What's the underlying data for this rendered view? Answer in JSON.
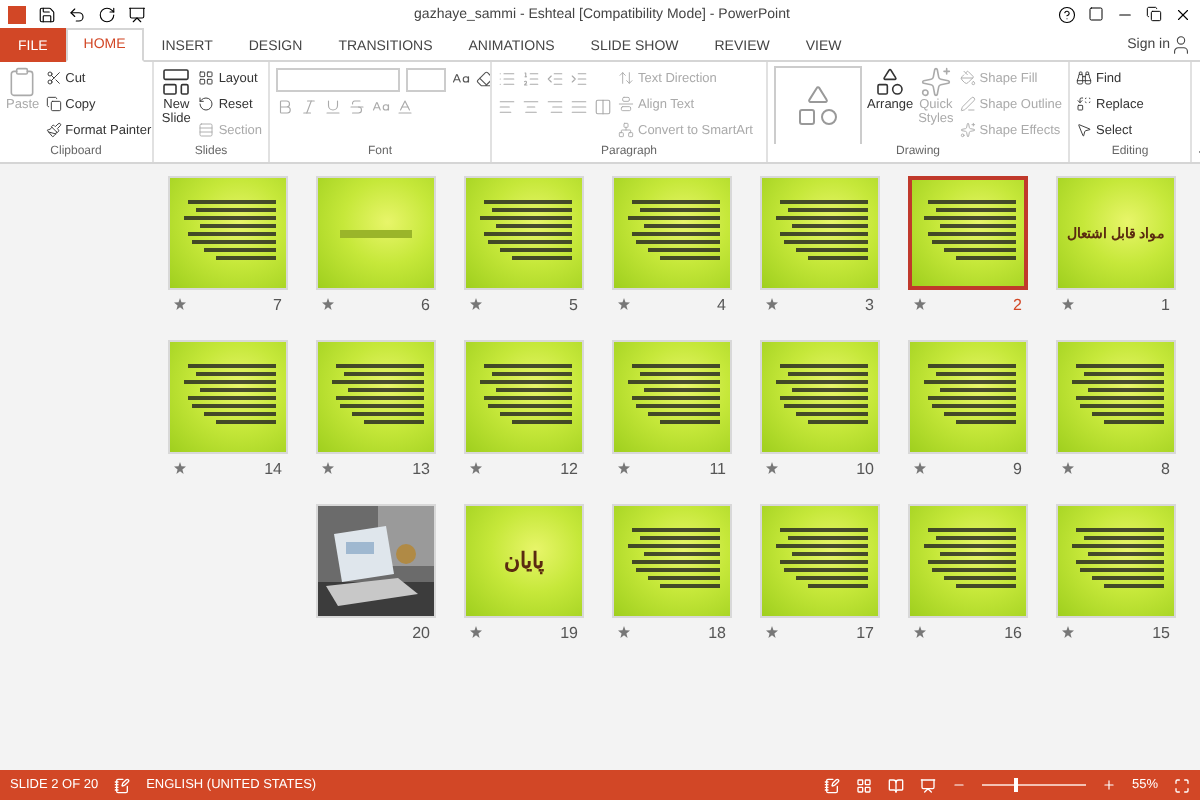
{
  "window": {
    "title": "gazhaye_sammi - Eshteal [Compatibility Mode] - PowerPoint"
  },
  "tabs": [
    {
      "label": "FILE",
      "kind": "file",
      "selected": false
    },
    {
      "label": "HOME",
      "kind": "tab",
      "selected": true
    },
    {
      "label": "INSERT",
      "kind": "tab",
      "selected": false
    },
    {
      "label": "DESIGN",
      "kind": "tab",
      "selected": false
    },
    {
      "label": "TRANSITIONS",
      "kind": "tab",
      "selected": false
    },
    {
      "label": "ANIMATIONS",
      "kind": "tab",
      "selected": false
    },
    {
      "label": "SLIDE SHOW",
      "kind": "tab",
      "selected": false
    },
    {
      "label": "REVIEW",
      "kind": "tab",
      "selected": false
    },
    {
      "label": "VIEW",
      "kind": "tab",
      "selected": false
    }
  ],
  "account": {
    "label": "Sign in"
  },
  "ribbon": {
    "groups": [
      {
        "label": "Clipboard",
        "commands": [
          {
            "label": "Paste",
            "kind": "large",
            "disabled": true
          },
          {
            "label": "Cut",
            "kind": "small",
            "disabled": false
          },
          {
            "label": "Copy",
            "kind": "small",
            "disabled": false
          },
          {
            "label": "Format Painter",
            "kind": "small",
            "disabled": false
          }
        ]
      },
      {
        "label": "Slides",
        "commands": [
          {
            "label": "New Slide",
            "kind": "large",
            "disabled": false
          },
          {
            "label": "Layout",
            "kind": "small",
            "disabled": false
          },
          {
            "label": "Reset",
            "kind": "small",
            "disabled": false
          },
          {
            "label": "Section",
            "kind": "small",
            "disabled": true
          }
        ]
      },
      {
        "label": "Font"
      },
      {
        "label": "Paragraph",
        "commands": [
          {
            "label": "Text Direction",
            "kind": "small",
            "disabled": true
          },
          {
            "label": "Align Text",
            "kind": "small",
            "disabled": true
          },
          {
            "label": "Convert to SmartArt",
            "kind": "small",
            "disabled": true
          }
        ]
      },
      {
        "label": "Drawing",
        "commands": [
          {
            "label": "Arrange",
            "kind": "large",
            "disabled": false
          },
          {
            "label": "Quick Styles",
            "kind": "large",
            "disabled": true
          },
          {
            "label": "Shape Fill",
            "kind": "small",
            "disabled": true
          },
          {
            "label": "Shape Outline",
            "kind": "small",
            "disabled": true
          },
          {
            "label": "Shape Effects",
            "kind": "small",
            "disabled": true
          }
        ]
      },
      {
        "label": "Editing",
        "commands": [
          {
            "label": "Find",
            "kind": "small",
            "disabled": false
          },
          {
            "label": "Replace",
            "kind": "small",
            "disabled": false
          },
          {
            "label": "Select",
            "kind": "small",
            "disabled": false
          }
        ]
      }
    ]
  },
  "slide_rows": [
    [
      {
        "number": "7",
        "kind": "text",
        "selected": false,
        "transition": true
      },
      {
        "number": "6",
        "kind": "faint",
        "selected": false,
        "transition": true
      },
      {
        "number": "5",
        "kind": "text",
        "selected": false,
        "transition": true
      },
      {
        "number": "4",
        "kind": "text",
        "selected": false,
        "transition": true
      },
      {
        "number": "3",
        "kind": "text",
        "selected": false,
        "transition": true
      },
      {
        "number": "2",
        "kind": "text",
        "selected": true,
        "transition": true
      },
      {
        "number": "1",
        "kind": "title",
        "title": "مواد قابل اشتعال",
        "selected": false,
        "transition": true
      }
    ],
    [
      {
        "number": "14",
        "kind": "text",
        "selected": false,
        "transition": true
      },
      {
        "number": "13",
        "kind": "text",
        "selected": false,
        "transition": true
      },
      {
        "number": "12",
        "kind": "text",
        "selected": false,
        "transition": true
      },
      {
        "number": "11",
        "kind": "text",
        "selected": false,
        "transition": true
      },
      {
        "number": "10",
        "kind": "text",
        "selected": false,
        "transition": true
      },
      {
        "number": "9",
        "kind": "text",
        "selected": false,
        "transition": true
      },
      {
        "number": "8",
        "kind": "text",
        "selected": false,
        "transition": true
      }
    ],
    [
      {
        "number": "20",
        "selected": false,
        "transition": false
      },
      {
        "number": "19",
        "kind": "title",
        "title": "پایان",
        "selected": false,
        "transition": true
      },
      {
        "number": "18",
        "kind": "text",
        "selected": false,
        "transition": true
      },
      {
        "number": "17",
        "kind": "text",
        "selected": false,
        "transition": true
      },
      {
        "number": "16",
        "kind": "text",
        "selected": false,
        "transition": true
      },
      {
        "number": "15",
        "kind": "text",
        "selected": false,
        "transition": true
      }
    ]
  ],
  "status_bar": {
    "slide": "SLIDE 2 OF 20",
    "language": "ENGLISH (UNITED STATES)",
    "zoom": "55%",
    "zoom_slider": {
      "level": 0.3
    }
  }
}
